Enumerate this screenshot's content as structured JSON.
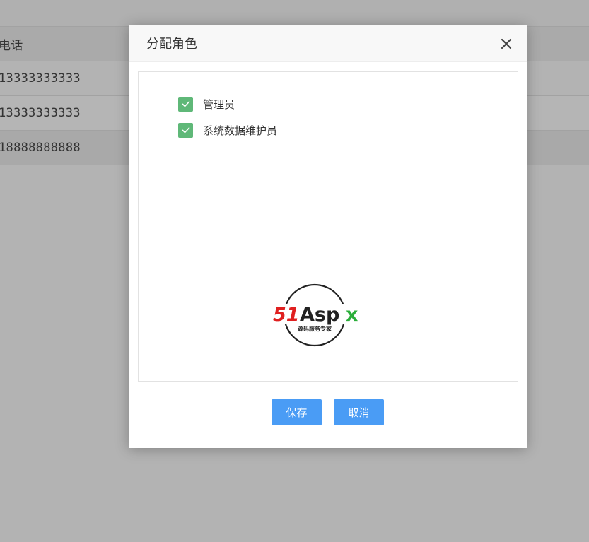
{
  "background_table": {
    "header": "电话",
    "rows": [
      "13333333333",
      "13333333333",
      "18888888888"
    ]
  },
  "dialog": {
    "title": "分配角色",
    "close_icon": "close-icon",
    "roles": [
      {
        "label": "管理员",
        "checked": true
      },
      {
        "label": "系统数据维护员",
        "checked": true
      }
    ],
    "logo": {
      "brand_red": "51",
      "brand_dark": "Asp",
      "brand_green": "x",
      "tagline": "源码服务专家"
    },
    "save_label": "保存",
    "cancel_label": "取消"
  },
  "colors": {
    "checkbox": "#5fb878",
    "button": "#4a9cf5",
    "overlay": "#b3b3b3"
  }
}
